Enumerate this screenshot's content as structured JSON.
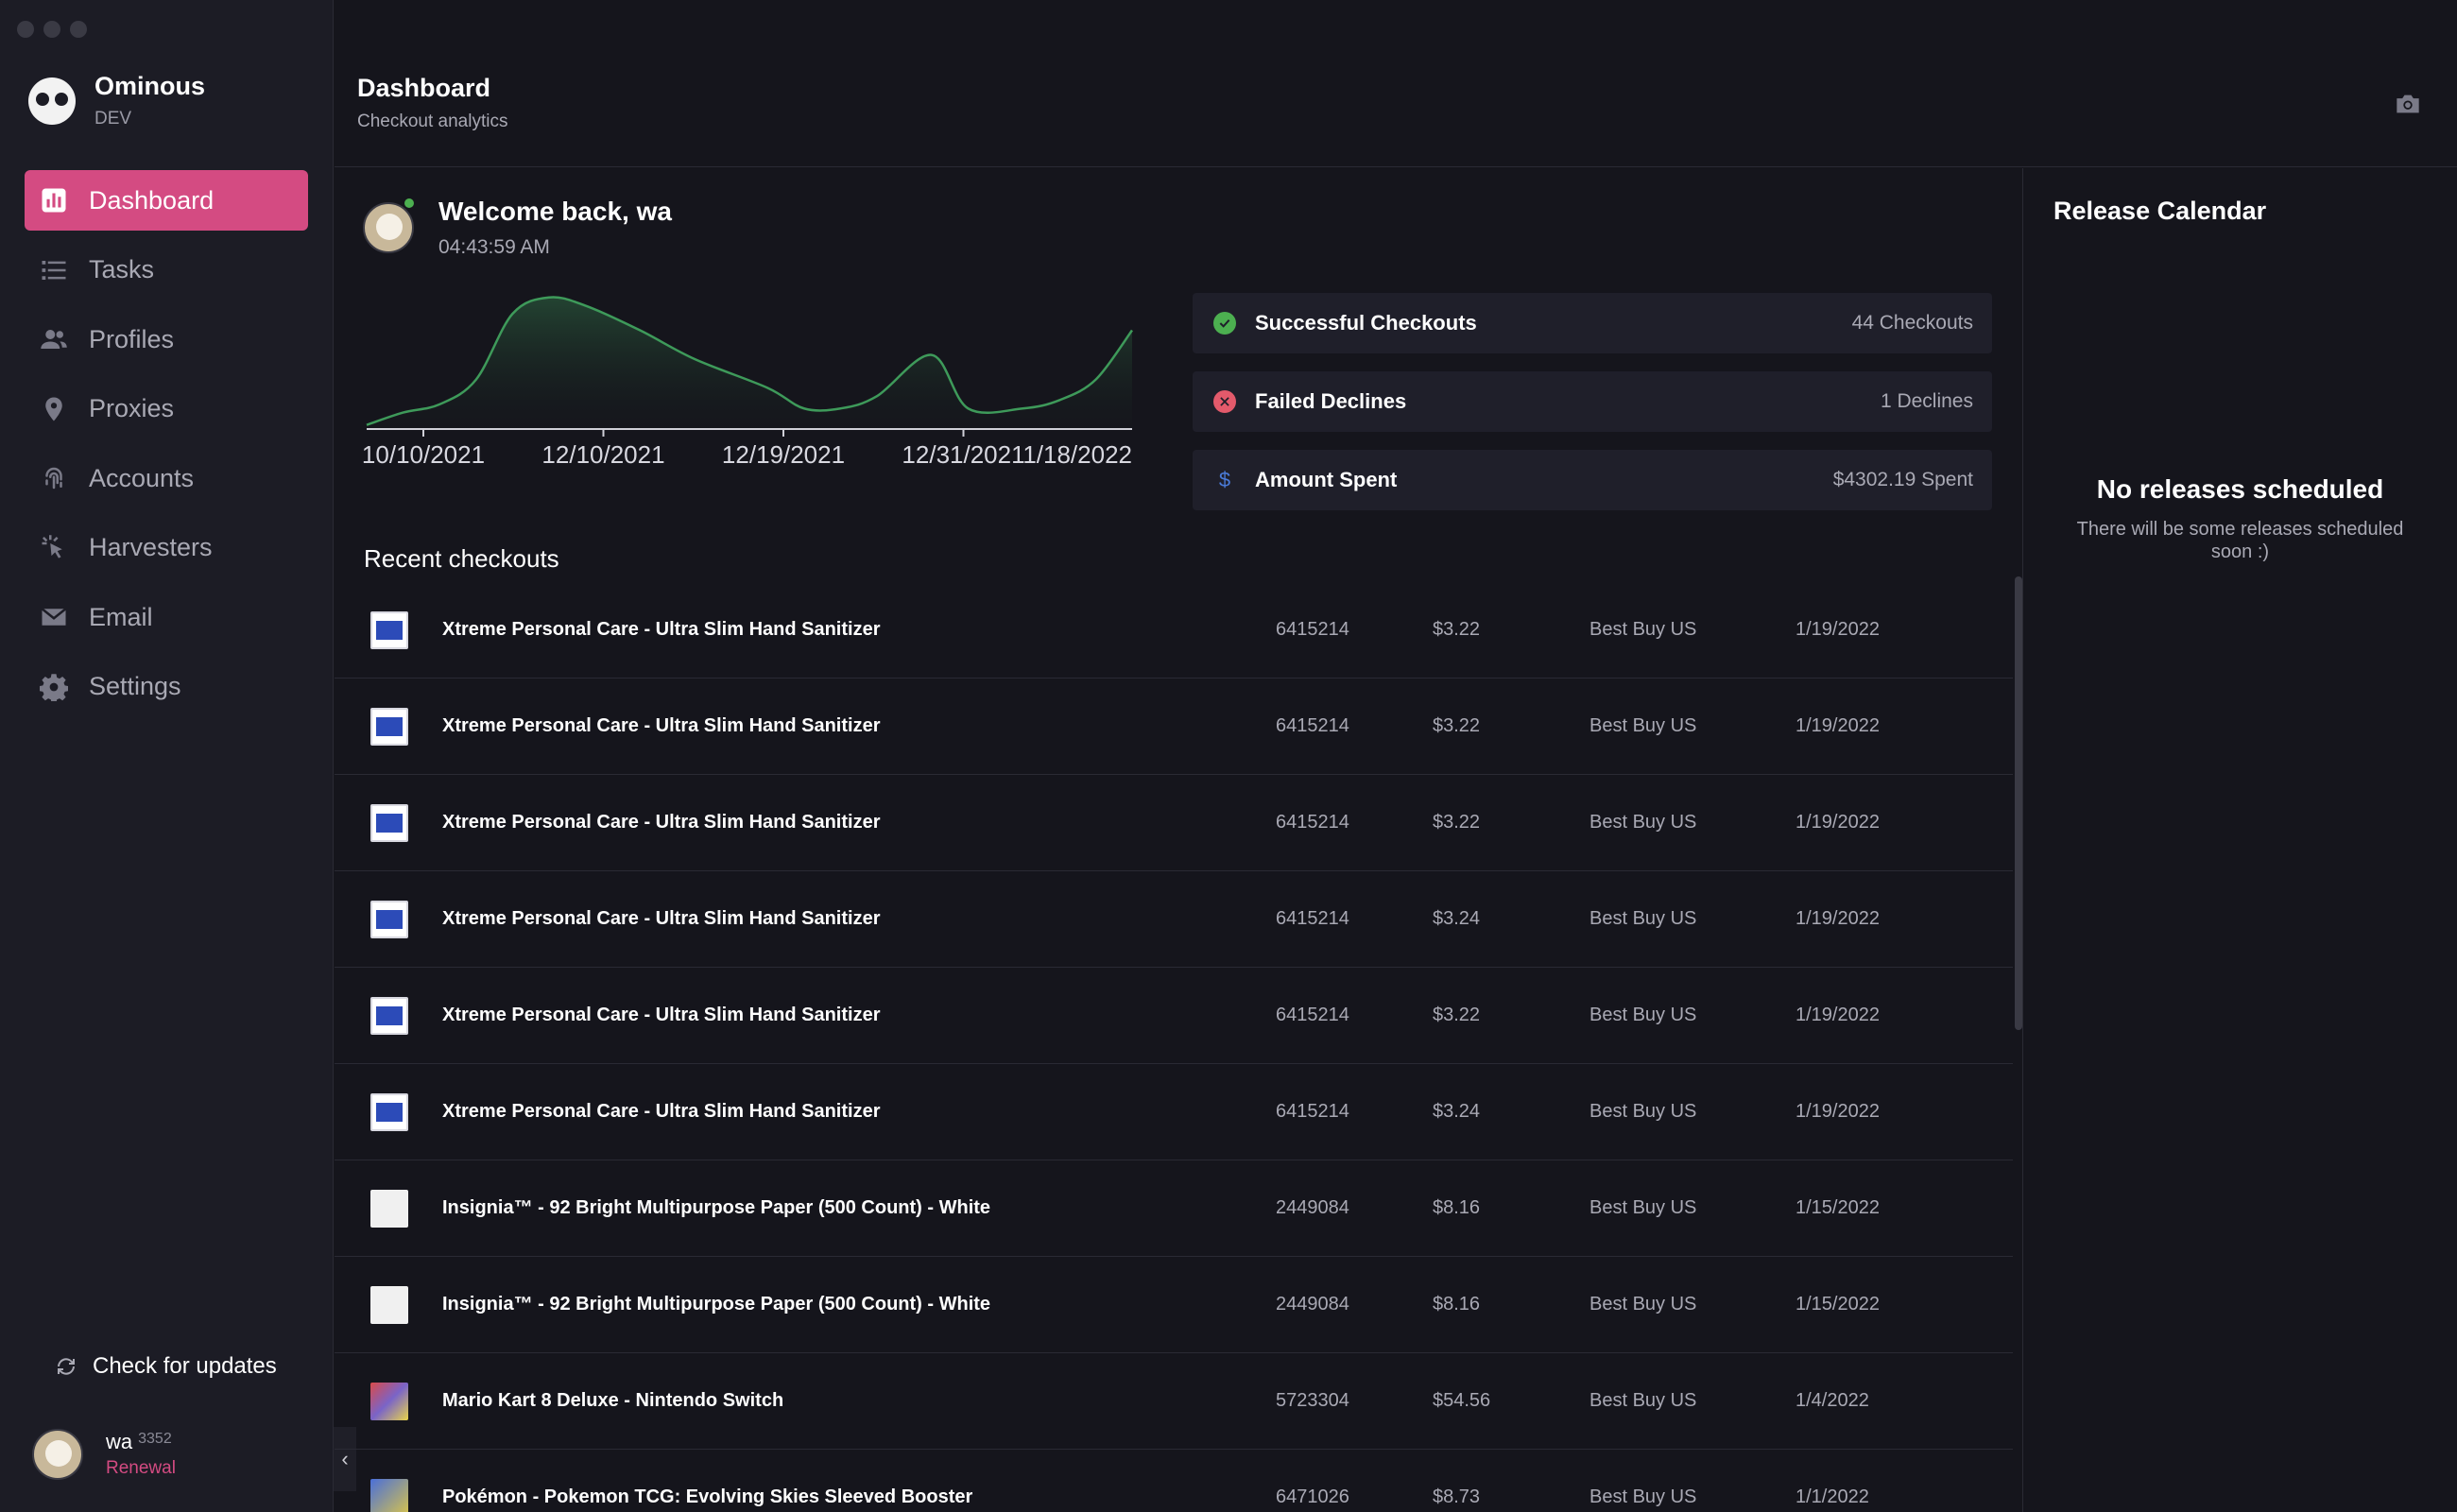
{
  "app": {
    "name": "Ominous",
    "env": "DEV"
  },
  "sidebar": {
    "items": [
      {
        "label": "Dashboard",
        "icon": "bar-chart-icon",
        "active": true
      },
      {
        "label": "Tasks",
        "icon": "list-icon"
      },
      {
        "label": "Profiles",
        "icon": "users-icon"
      },
      {
        "label": "Proxies",
        "icon": "location-pin-icon"
      },
      {
        "label": "Accounts",
        "icon": "fingerprint-icon"
      },
      {
        "label": "Harvesters",
        "icon": "cursor-click-icon"
      },
      {
        "label": "Email",
        "icon": "envelope-icon"
      },
      {
        "label": "Settings",
        "icon": "gear-icon"
      }
    ],
    "updates_label": "Check for updates",
    "user": {
      "name": "wa",
      "id": "3352",
      "status": "Renewal"
    }
  },
  "header": {
    "title": "Dashboard",
    "subtitle": "Checkout analytics"
  },
  "welcome": {
    "title": "Welcome back, wa",
    "time": "04:43:59 AM"
  },
  "chart_data": {
    "type": "area",
    "x_tick_labels": [
      "10/10/2021",
      "12/10/2021",
      "12/19/2021",
      "12/31/2021",
      "1/18/2022"
    ],
    "points": [
      {
        "x": 0,
        "y": 0.5
      },
      {
        "x": 2,
        "y": 2
      },
      {
        "x": 4,
        "y": 3
      },
      {
        "x": 6,
        "y": 6
      },
      {
        "x": 8,
        "y": 14
      },
      {
        "x": 10,
        "y": 16
      },
      {
        "x": 12,
        "y": 15
      },
      {
        "x": 15,
        "y": 12
      },
      {
        "x": 18,
        "y": 8.5
      },
      {
        "x": 22,
        "y": 5
      },
      {
        "x": 24,
        "y": 2.5
      },
      {
        "x": 26,
        "y": 2.5
      },
      {
        "x": 28,
        "y": 4
      },
      {
        "x": 31,
        "y": 9
      },
      {
        "x": 33,
        "y": 2.5
      },
      {
        "x": 36,
        "y": 2.5
      },
      {
        "x": 38,
        "y": 3.5
      },
      {
        "x": 40,
        "y": 6
      },
      {
        "x": 42,
        "y": 12
      }
    ],
    "ylim": [
      0,
      17
    ],
    "xlim": [
      0,
      42
    ],
    "line_color": "#3e9a5a",
    "grid": false
  },
  "stats": [
    {
      "label": "Successful Checkouts",
      "value": "44 Checkouts",
      "icon": "check-circle-icon",
      "color": "#4caf50"
    },
    {
      "label": "Failed Declines",
      "value": "1 Declines",
      "icon": "x-circle-icon",
      "color": "#e35a6b"
    },
    {
      "label": "Amount Spent",
      "value": "$4302.19 Spent",
      "icon": "dollar-icon",
      "color": "#4a7bd9"
    }
  ],
  "recent": {
    "title": "Recent checkouts",
    "rows": [
      {
        "name": "Xtreme Personal Care - Ultra Slim Hand Sanitizer",
        "sku": "6415214",
        "price": "$3.22",
        "store": "Best Buy US",
        "date": "1/19/2022",
        "thumb": "blue"
      },
      {
        "name": "Xtreme Personal Care - Ultra Slim Hand Sanitizer",
        "sku": "6415214",
        "price": "$3.22",
        "store": "Best Buy US",
        "date": "1/19/2022",
        "thumb": "blue"
      },
      {
        "name": "Xtreme Personal Care - Ultra Slim Hand Sanitizer",
        "sku": "6415214",
        "price": "$3.22",
        "store": "Best Buy US",
        "date": "1/19/2022",
        "thumb": "blue"
      },
      {
        "name": "Xtreme Personal Care - Ultra Slim Hand Sanitizer",
        "sku": "6415214",
        "price": "$3.24",
        "store": "Best Buy US",
        "date": "1/19/2022",
        "thumb": "blue"
      },
      {
        "name": "Xtreme Personal Care - Ultra Slim Hand Sanitizer",
        "sku": "6415214",
        "price": "$3.22",
        "store": "Best Buy US",
        "date": "1/19/2022",
        "thumb": "blue"
      },
      {
        "name": "Xtreme Personal Care - Ultra Slim Hand Sanitizer",
        "sku": "6415214",
        "price": "$3.24",
        "store": "Best Buy US",
        "date": "1/19/2022",
        "thumb": "blue"
      },
      {
        "name": "Insignia™ - 92 Bright Multipurpose Paper (500 Count) - White",
        "sku": "2449084",
        "price": "$8.16",
        "store": "Best Buy US",
        "date": "1/15/2022",
        "thumb": "paper"
      },
      {
        "name": "Insignia™ - 92 Bright Multipurpose Paper (500 Count) - White",
        "sku": "2449084",
        "price": "$8.16",
        "store": "Best Buy US",
        "date": "1/15/2022",
        "thumb": "paper"
      },
      {
        "name": "Mario Kart 8 Deluxe - Nintendo Switch",
        "sku": "5723304",
        "price": "$54.56",
        "store": "Best Buy US",
        "date": "1/4/2022",
        "thumb": "mario"
      },
      {
        "name": "Pokémon - Pokemon TCG: Evolving Skies Sleeved Booster",
        "sku": "6471026",
        "price": "$8.73",
        "store": "Best Buy US",
        "date": "1/1/2022",
        "thumb": "poke"
      }
    ]
  },
  "release_calendar": {
    "title": "Release Calendar",
    "empty_title": "No releases scheduled",
    "empty_text": "There will be some releases scheduled soon :)"
  }
}
